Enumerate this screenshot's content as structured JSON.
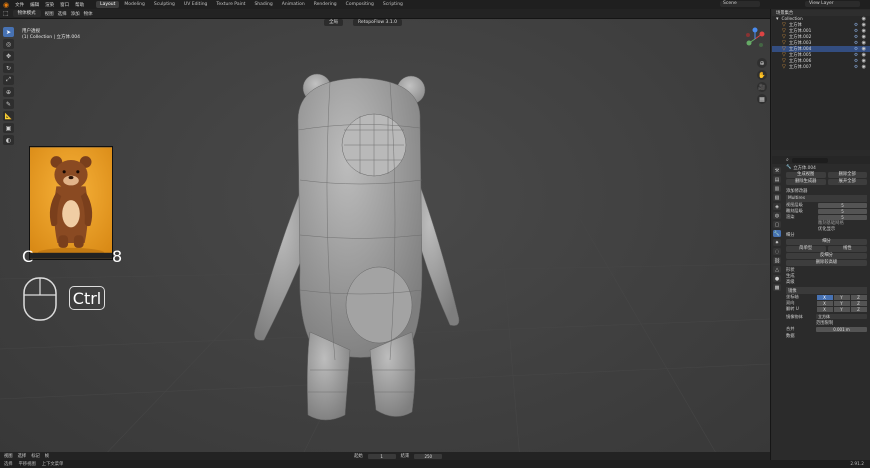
{
  "menu": [
    "文件",
    "编辑",
    "渲染",
    "窗口",
    "帮助"
  ],
  "workspaces": [
    {
      "label": "Layout",
      "active": true
    },
    {
      "label": "Modeling",
      "active": false
    },
    {
      "label": "Sculpting",
      "active": false
    },
    {
      "label": "UV Editing",
      "active": false
    },
    {
      "label": "Texture Paint",
      "active": false
    },
    {
      "label": "Shading",
      "active": false
    },
    {
      "label": "Animation",
      "active": false
    },
    {
      "label": "Rendering",
      "active": false
    },
    {
      "label": "Compositing",
      "active": false
    },
    {
      "label": "Scripting",
      "active": false
    }
  ],
  "scene": "Scene",
  "view_layer": "View Layer",
  "header2": {
    "mode": "物体模式",
    "items": [
      "视图",
      "选择",
      "添加",
      "物体"
    ]
  },
  "viewport": {
    "info_line1": "用户透视",
    "info_line2": "(1) Collection | 立方体.004",
    "transform_global": "全局",
    "retopo_addon": "RetopoFlow 3.1.0"
  },
  "overlay": {
    "key_left": "C",
    "key_right": "8",
    "ctrl": "Ctrl"
  },
  "outliner": {
    "title": "场景集合",
    "collection": "Collection",
    "objects": [
      "立方体",
      "立方体.001",
      "立方体.002",
      "立方体.003",
      "立方体.004",
      "立方体.005",
      "立方体.006",
      "立方体.007"
    ]
  },
  "properties": {
    "object_name": "立方体.004",
    "btn_a": "生成视图",
    "btn_b": "删除全部",
    "btn_c": "删除生成器",
    "btn_d": "展开全部",
    "add_modifier": "添加修改器",
    "mod1": {
      "name": "Multires",
      "rows": [
        {
          "label": "视图层级",
          "value": "5"
        },
        {
          "label": "雕刻层级",
          "value": "5"
        },
        {
          "label": "渲染",
          "value": "5"
        }
      ],
      "check1": "雕刻基础网格",
      "check2": "优化显示",
      "section": "细分",
      "btn1": "细分",
      "btn2a": "简单型",
      "btn2b": "线性",
      "btn3": "反细分",
      "btn4": "删除较高级",
      "sub1": "形状",
      "sub2": "生成",
      "sub3": "高级"
    },
    "mod2": {
      "name": "镜像",
      "rows": [
        {
          "label": "坐标轴"
        },
        {
          "label": "双向"
        },
        {
          "label": "翻转 U"
        }
      ],
      "xyz": [
        "X",
        "Y",
        "Z"
      ],
      "mirror_obj_label": "镜像物体",
      "mirror_obj": "立方体",
      "clip_label": "范围限制",
      "merge_label": "合并",
      "merge_value": "0.001 m",
      "data": "数据"
    }
  },
  "bottombar": [
    "视图",
    "选择",
    "标记",
    "帧",
    "起始",
    "1",
    "结束",
    "250"
  ],
  "statusbar": [
    "选择",
    "平移视图",
    "上下文菜单"
  ],
  "version": "2.91.2"
}
